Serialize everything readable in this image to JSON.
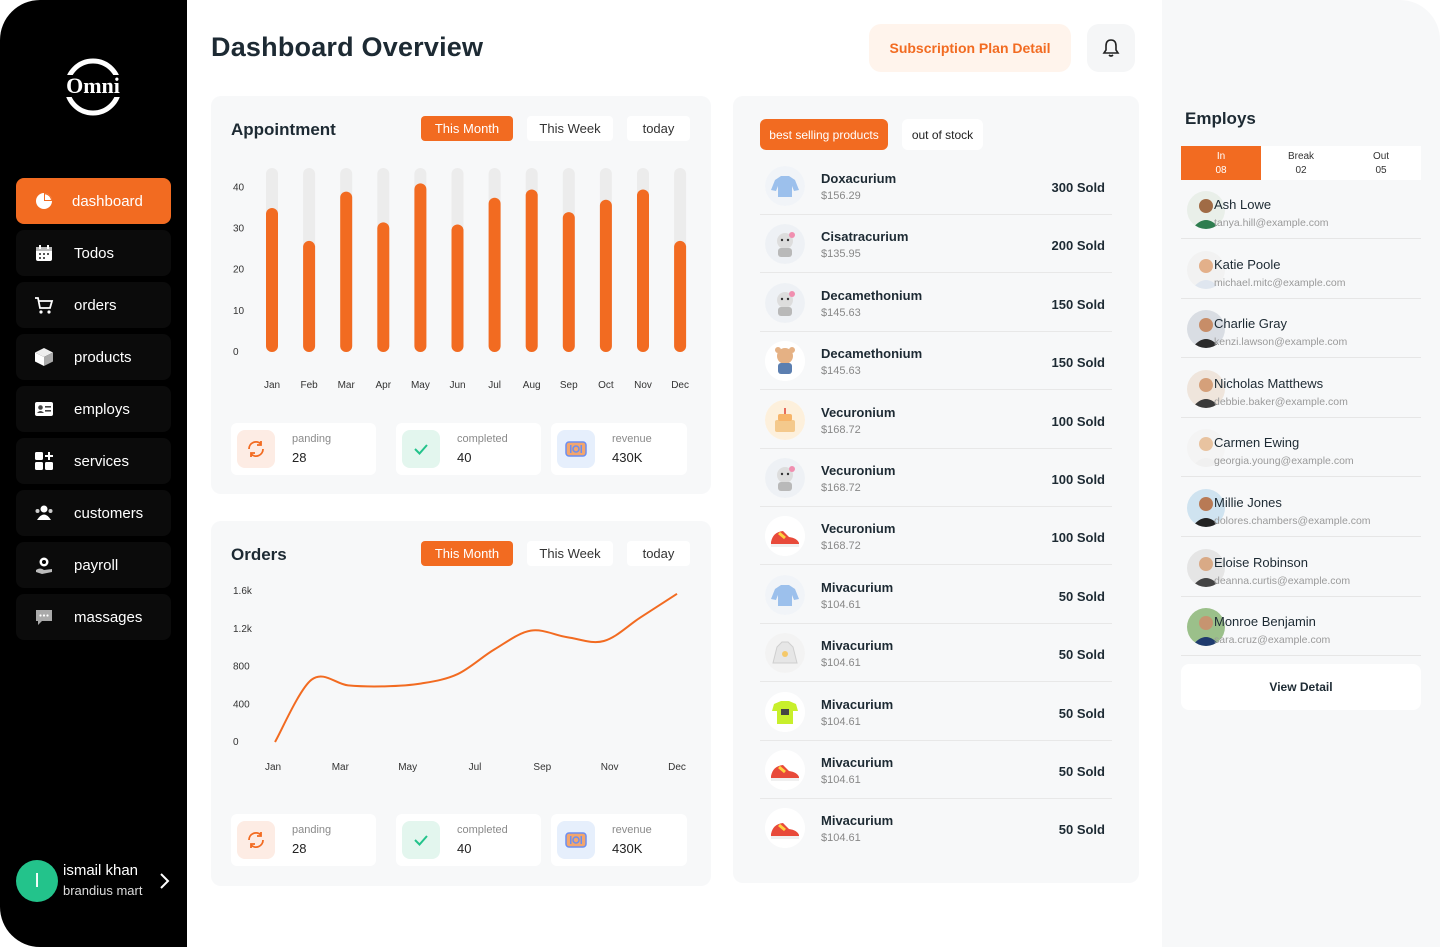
{
  "brand": {
    "logo_text": "Omni",
    "accent": "#f26b21",
    "dark": "#000000"
  },
  "header": {
    "title": "Dashboard Overview",
    "subscription_label": "Subscription Plan Detail",
    "bell_icon": "bell-icon"
  },
  "sidebar": {
    "items": [
      {
        "label": "dashboard",
        "icon": "pie-chart-icon",
        "active": true
      },
      {
        "label": "Todos",
        "icon": "calendar-icon"
      },
      {
        "label": "orders",
        "icon": "cart-icon"
      },
      {
        "label": "products",
        "icon": "box-icon"
      },
      {
        "label": "employs",
        "icon": "id-card-icon"
      },
      {
        "label": "services",
        "icon": "grid-plus-icon"
      },
      {
        "label": "customers",
        "icon": "users-icon"
      },
      {
        "label": "payroll",
        "icon": "payroll-icon"
      },
      {
        "label": "massages",
        "icon": "chat-icon"
      }
    ],
    "user": {
      "initial": "I",
      "name": "ismail khan",
      "org": "brandius mart"
    }
  },
  "appointment": {
    "title": "Appointment",
    "tabs": [
      "This Month",
      "This Week",
      "today"
    ],
    "stats": [
      {
        "label": "panding",
        "value": "28"
      },
      {
        "label": "completed",
        "value": "40"
      },
      {
        "label": "revenue",
        "value": "430K"
      }
    ]
  },
  "orders": {
    "title": "Orders",
    "tabs": [
      "This Month",
      "This Week",
      "today"
    ],
    "stats": [
      {
        "label": "panding",
        "value": "28"
      },
      {
        "label": "completed",
        "value": "40"
      },
      {
        "label": "revenue",
        "value": "430K"
      }
    ]
  },
  "chart_data": [
    {
      "type": "bar",
      "categories": [
        "Jan",
        "Feb",
        "Mar",
        "Apr",
        "May",
        "Jun",
        "Jul",
        "Aug",
        "Sep",
        "Oct",
        "Nov",
        "Dec"
      ],
      "values": [
        35,
        27,
        39,
        31.5,
        41,
        31,
        37.5,
        39.5,
        34,
        37,
        39.5,
        27
      ],
      "yticks": [
        "40",
        "30",
        "20",
        "10",
        "0"
      ],
      "ylim": [
        0,
        44
      ],
      "title": "",
      "color": "#f26b21"
    },
    {
      "type": "line",
      "x": [
        "Jan",
        "Feb",
        "Mar",
        "Apr",
        "May",
        "Jun",
        "Jul",
        "Aug",
        "Sep",
        "Oct",
        "Nov",
        "Dec"
      ],
      "xticks": [
        "Jan",
        "Mar",
        "May",
        "Jul",
        "Sep",
        "Nov",
        "Dec"
      ],
      "values": [
        0,
        660,
        600,
        590,
        620,
        720,
        980,
        1180,
        1110,
        1070,
        1320,
        1570
      ],
      "yticks": [
        "1.6k",
        "1.2k",
        "800",
        "400",
        "0"
      ],
      "ylim": [
        0,
        1600
      ],
      "color": "#f26b21"
    }
  ],
  "products": {
    "tabs": [
      "best selling products",
      "out of stock"
    ],
    "items": [
      {
        "name": "Doxacurium",
        "price": "$156.29",
        "sold": "300 Sold",
        "thumb": "sweater-icon"
      },
      {
        "name": "Cisatracurium",
        "price": "$135.95",
        "sold": "200 Sold",
        "thumb": "toy-icon"
      },
      {
        "name": "Decamethonium",
        "price": "$145.63",
        "sold": "150 Sold",
        "thumb": "toy-icon"
      },
      {
        "name": "Decamethonium",
        "price": "$145.63",
        "sold": "150 Sold",
        "thumb": "bear-icon"
      },
      {
        "name": "Vecuronium",
        "price": "$168.72",
        "sold": "100 Sold",
        "thumb": "cake-icon"
      },
      {
        "name": "Vecuronium",
        "price": "$168.72",
        "sold": "100 Sold",
        "thumb": "toy-icon"
      },
      {
        "name": "Vecuronium",
        "price": "$168.72",
        "sold": "100 Sold",
        "thumb": "shoe-icon"
      },
      {
        "name": "Mivacurium",
        "price": "$104.61",
        "sold": "50 Sold",
        "thumb": "sweater-icon"
      },
      {
        "name": "Mivacurium",
        "price": "$104.61",
        "sold": "50 Sold",
        "thumb": "hoodie-icon"
      },
      {
        "name": "Mivacurium",
        "price": "$104.61",
        "sold": "50 Sold",
        "thumb": "tshirt-icon"
      },
      {
        "name": "Mivacurium",
        "price": "$104.61",
        "sold": "50 Sold",
        "thumb": "shoe-icon"
      },
      {
        "name": "Mivacurium",
        "price": "$104.61",
        "sold": "50 Sold",
        "thumb": "shoe-icon"
      }
    ]
  },
  "employs": {
    "title": "Employs",
    "tabs": [
      {
        "label": "In",
        "count": "08"
      },
      {
        "label": "Break",
        "count": "02"
      },
      {
        "label": "Out",
        "count": "05"
      }
    ],
    "people": [
      {
        "name": "Ash Lowe",
        "email": "tanya.hill@example.com"
      },
      {
        "name": "Katie Poole",
        "email": "michael.mitc@example.com"
      },
      {
        "name": "Charlie Gray",
        "email": "kenzi.lawson@example.com"
      },
      {
        "name": "Nicholas Matthews",
        "email": "debbie.baker@example.com"
      },
      {
        "name": "Carmen Ewing",
        "email": "georgia.young@example.com"
      },
      {
        "name": "Millie Jones",
        "email": "dolores.chambers@example.com"
      },
      {
        "name": "Eloise Robinson",
        "email": "deanna.curtis@example.com"
      },
      {
        "name": "Monroe Benjamin",
        "email": "sara.cruz@example.com"
      }
    ],
    "view_label": "View Detail"
  }
}
